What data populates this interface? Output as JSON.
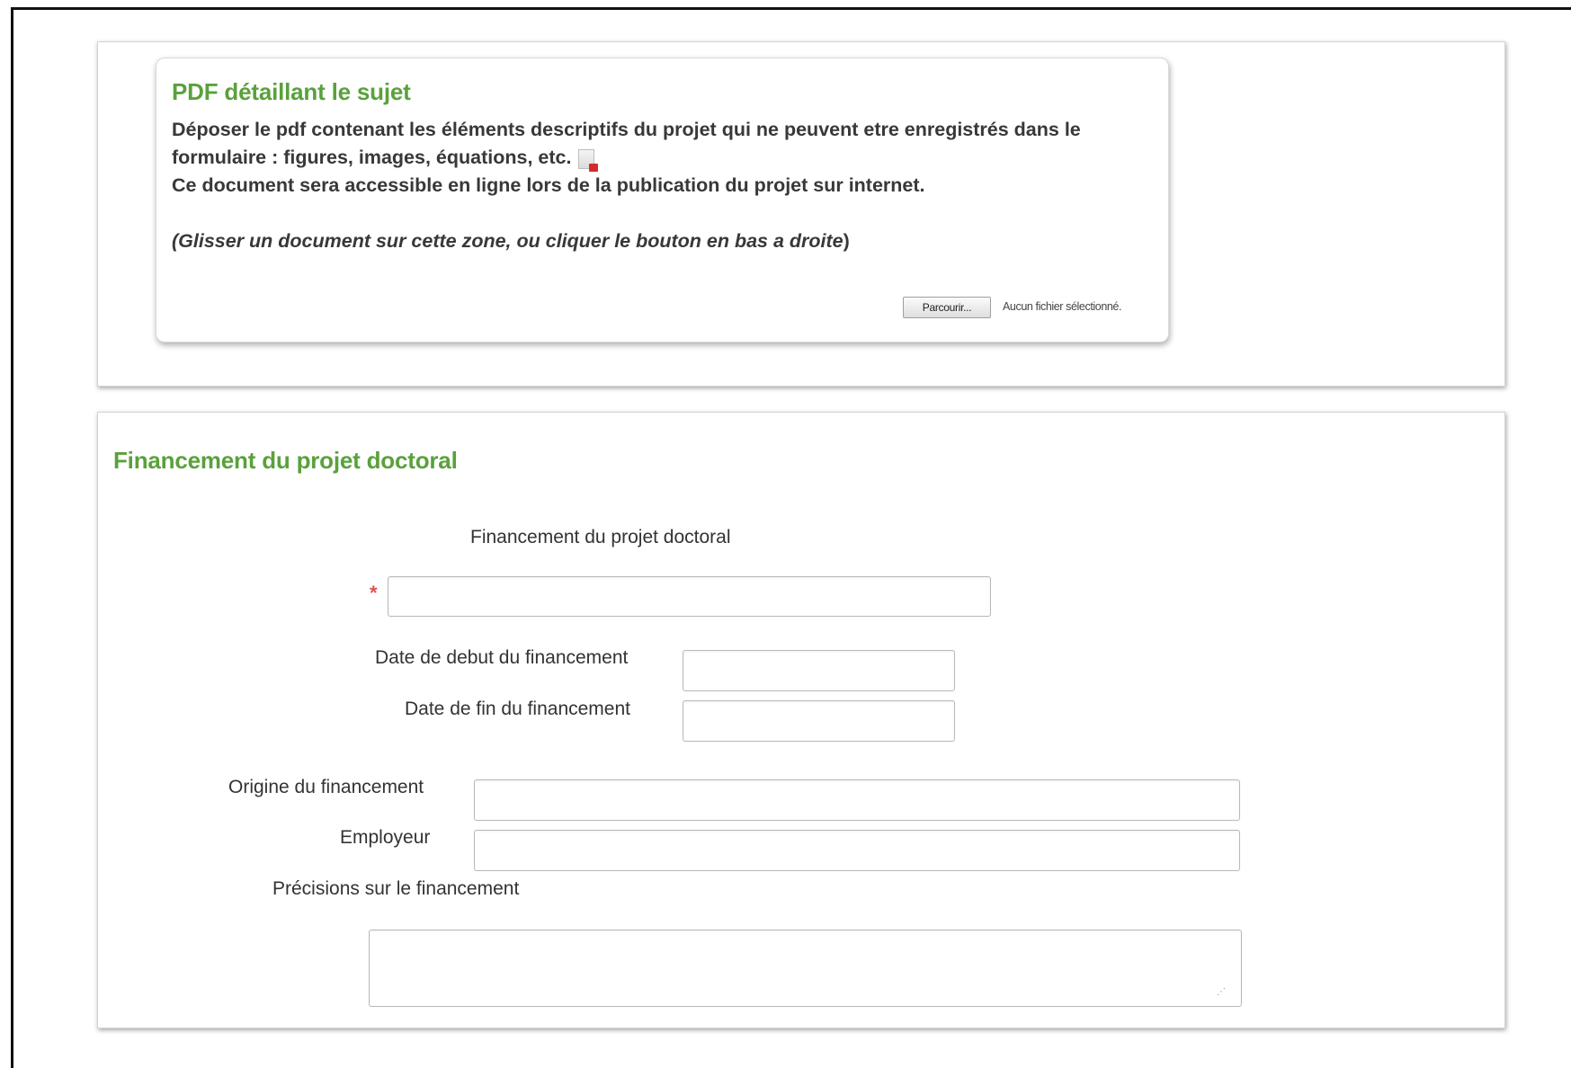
{
  "upload": {
    "title": "PDF détaillant le sujet",
    "line1": "Déposer le pdf contenant les éléments descriptifs du projet qui ne peuvent etre enregistrés dans le",
    "line2": "formulaire : figures, images, équations, etc.",
    "line3": "Ce document sera accessible en ligne lors de la publication du projet sur internet.",
    "hint": "(Glisser un document sur cette zone, ou cliquer le bouton en bas a droite",
    "hint_close": ")",
    "browse_label": "Parcourir...",
    "no_file_text": "Aucun fichier sélectionné."
  },
  "funding": {
    "section_title": "Financement du projet doctoral",
    "funding_label": "Financement du projet doctoral",
    "required_marker": "*",
    "funding_value": "",
    "start_label": "Date de debut du financement",
    "start_value": "",
    "end_label": "Date de fin du financement",
    "end_value": "",
    "origin_label": "Origine du financement",
    "origin_value": "",
    "employer_label": "Employeur",
    "employer_value": "",
    "details_label": "Précisions sur le financement",
    "details_value": ""
  },
  "icons": {
    "pdf": "pdf-file-icon",
    "resize": "resize-grip-icon"
  },
  "colors": {
    "title_green": "#5aa13c",
    "required_red": "#e05050"
  }
}
